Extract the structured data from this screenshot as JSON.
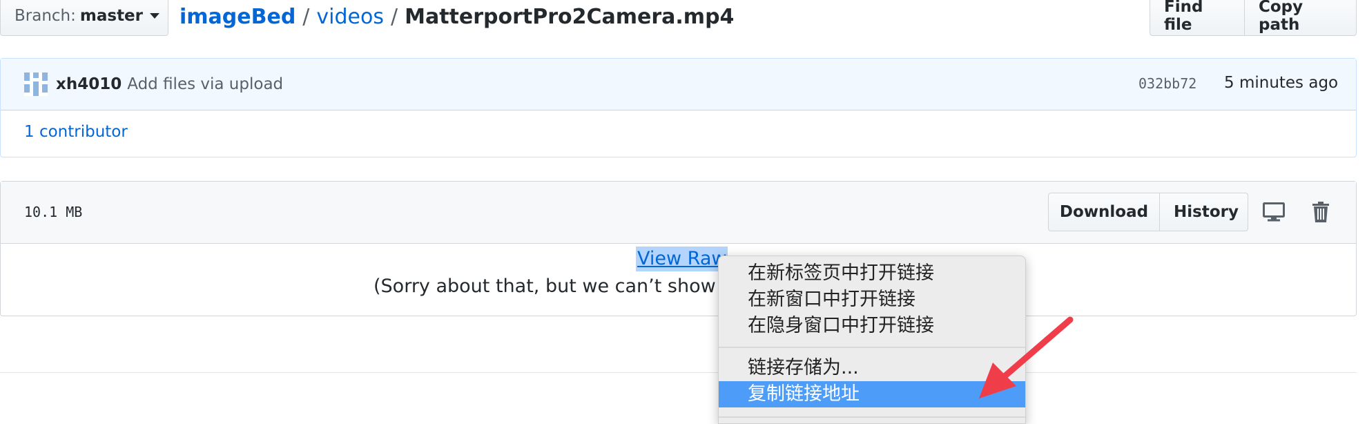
{
  "branch": {
    "label": "Branch:",
    "value": "master"
  },
  "breadcrumb": {
    "repo": "imageBed",
    "dir": "videos",
    "file": "MatterportPro2Camera.mp4",
    "separator": "/"
  },
  "top_actions": {
    "find_file": "Find file",
    "copy_path": "Copy path"
  },
  "commit": {
    "author": "xh4010",
    "message": "Add files via upload",
    "sha": "032bb72",
    "time": "5 minutes ago",
    "contributors_count": "1",
    "contributors_text": "contributor"
  },
  "file": {
    "size": "10.1 MB",
    "download_label": "Download",
    "history_label": "History",
    "view_raw_label": "View Raw",
    "notice": "(Sorry about that, but we can’t show fil"
  },
  "icons": {
    "desktop": "desktop-icon",
    "trash": "trash-icon",
    "avatar": "identicon-avatar",
    "caret": "caret-down-icon"
  },
  "context_menu": {
    "group1": [
      "在新标签页中打开链接",
      "在新窗口中打开链接",
      "在隐身窗口中打开链接"
    ],
    "group2": [
      "链接存储为...",
      "复制链接地址"
    ],
    "highlighted_index": 1
  },
  "colors": {
    "link": "#0366d6",
    "commit_bg": "#f1f8ff",
    "menu_highlight": "#4d9df8",
    "annotation_arrow": "#ef3d4a"
  }
}
